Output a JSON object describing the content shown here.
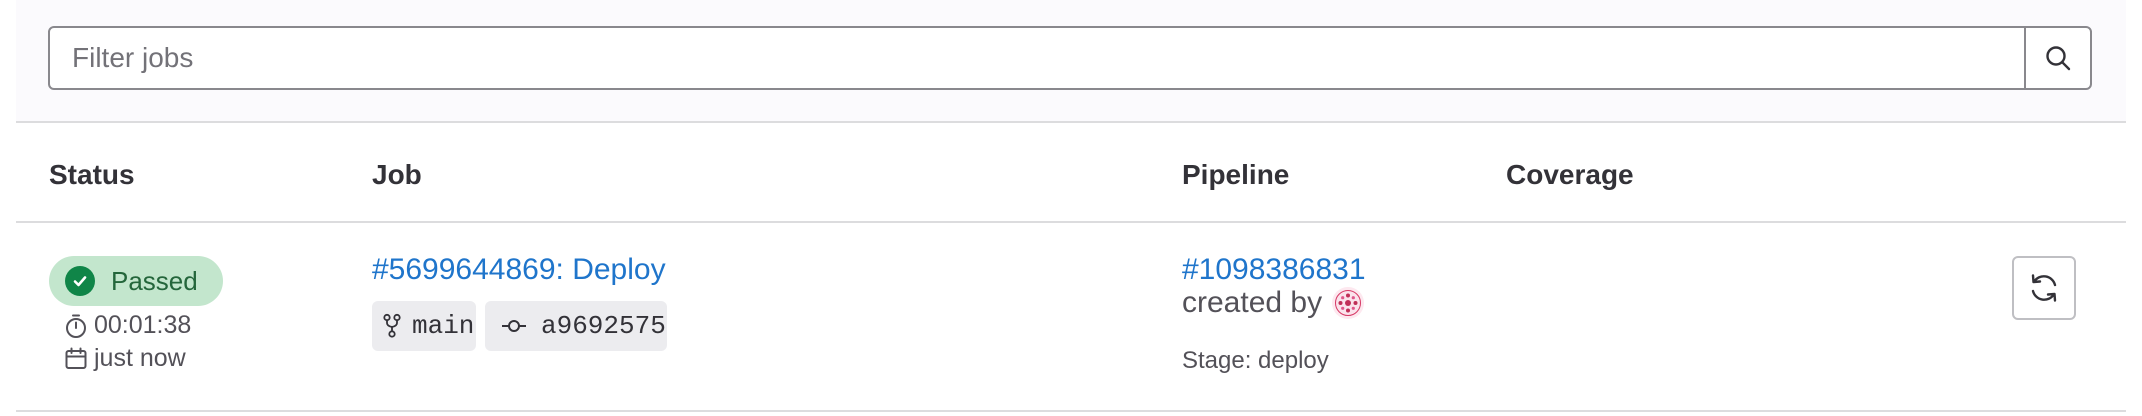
{
  "filter": {
    "placeholder": "Filter jobs",
    "search_icon": "search-icon"
  },
  "table": {
    "headers": {
      "status": "Status",
      "job": "Job",
      "pipeline": "Pipeline",
      "coverage": "Coverage"
    },
    "rows": [
      {
        "status": {
          "label": "Passed",
          "icon": "check-circle-icon",
          "color": "#108548"
        },
        "duration": "00:01:38",
        "finished": "just now",
        "job": {
          "title": "#5699644869: Deploy",
          "branch": "main",
          "commit": "a9692575"
        },
        "pipeline": {
          "id": "#1098386831",
          "created_by": "created by",
          "stage": "Stage: deploy"
        },
        "coverage": "",
        "action_icon": "retry-icon"
      }
    ]
  },
  "colors": {
    "accent": "#1f75cb",
    "success_bg": "#c3e6cd",
    "success_text": "#24663b",
    "border": "#dcdcde"
  }
}
